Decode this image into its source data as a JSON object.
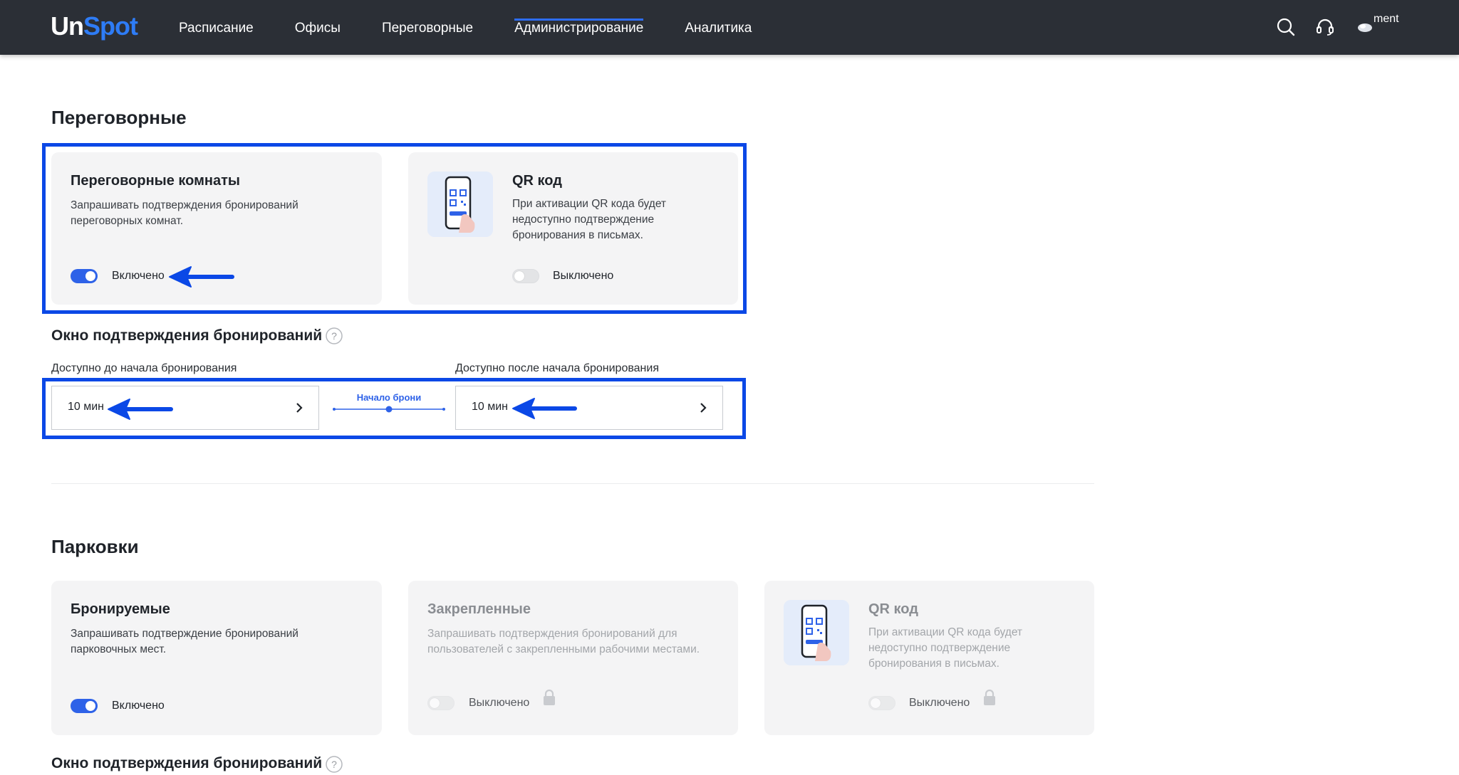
{
  "app": {
    "logo_prefix": "Un",
    "logo_suffix": "Spot",
    "nav": [
      {
        "label": "Расписание"
      },
      {
        "label": "Офисы"
      },
      {
        "label": "Переговорные"
      },
      {
        "label": "Администрирование",
        "active": true
      },
      {
        "label": "Аналитика"
      }
    ],
    "account_label": "ment",
    "icons": [
      "search-icon",
      "headset-icon",
      "account-icon"
    ]
  },
  "meeting_rooms": {
    "section_title": "Переговорные",
    "rooms_card": {
      "title": "Переговорные комнаты",
      "description": "Запрашивать подтверждения бронирований переговорных комнат.",
      "toggle_on": true,
      "toggle_label": "Включено"
    },
    "qr_card": {
      "title": "QR код",
      "description": "При активации QR кода будет недоступно подтверждение бронирования в письмах.",
      "toggle_on": false,
      "toggle_label": "Выключено"
    },
    "window": {
      "title": "Окно подтверждения бронирований",
      "before_label": "Доступно до начала бронирования",
      "before_value": "10 мин",
      "timeline_label": "Начало брони",
      "after_label": "Доступно после начала бронирования",
      "after_value": "10 мин"
    }
  },
  "parking": {
    "section_title": "Парковки",
    "bookable_card": {
      "title": "Бронируемые",
      "description": "Запрашивать подтверждение бронирований парковочных мест.",
      "toggle_on": true,
      "toggle_label": "Включено"
    },
    "fixed_card": {
      "title": "Закрепленные",
      "description": "Запрашивать подтверждения бронирований для пользователей с закрепленными рабочими местами.",
      "toggle_on": false,
      "toggle_label": "Выключено",
      "locked": true
    },
    "qr_card": {
      "title": "QR код",
      "description": "При активации QR кода будет недоступно подтверждение бронирования в письмах.",
      "toggle_on": false,
      "toggle_label": "Выключено",
      "locked": true
    },
    "window_title": "Окно подтверждения бронирований"
  },
  "colors": {
    "topbar": "#2b2f36",
    "accent": "#2e62e8",
    "annotation": "#0b48e6",
    "card_bg": "#f4f4f5"
  }
}
